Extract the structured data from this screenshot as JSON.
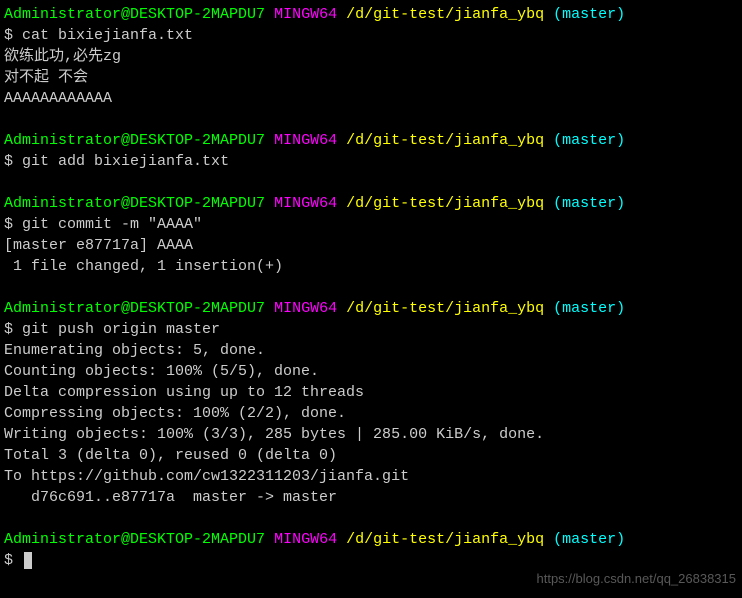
{
  "prompt": {
    "user": "Administrator@DESKTOP-2MAPDU7",
    "mingw": "MINGW64",
    "path": "/d/git-test/jianfa_ybq",
    "branch": "(master)"
  },
  "block1": {
    "cmd": "cat bixiejianfa.txt",
    "out1": "欲练此功,必先zg",
    "out2": "对不起 不会",
    "out3": "AAAAAAAAAAAA"
  },
  "block2": {
    "cmd": "git add bixiejianfa.txt"
  },
  "block3": {
    "cmd": "git commit -m \"AAAA\"",
    "out1": "[master e87717a] AAAA",
    "out2": " 1 file changed, 1 insertion(+)"
  },
  "block4": {
    "cmd": "git push origin master",
    "out1": "Enumerating objects: 5, done.",
    "out2": "Counting objects: 100% (5/5), done.",
    "out3": "Delta compression using up to 12 threads",
    "out4": "Compressing objects: 100% (2/2), done.",
    "out5": "Writing objects: 100% (3/3), 285 bytes | 285.00 KiB/s, done.",
    "out6": "Total 3 (delta 0), reused 0 (delta 0)",
    "out7": "To https://github.com/cw1322311203/jianfa.git",
    "out8": "   d76c691..e87717a  master -> master"
  },
  "block5": {
    "cmd": ""
  },
  "symbols": {
    "dollar": "$"
  },
  "watermark": "https://blog.csdn.net/qq_26838315"
}
